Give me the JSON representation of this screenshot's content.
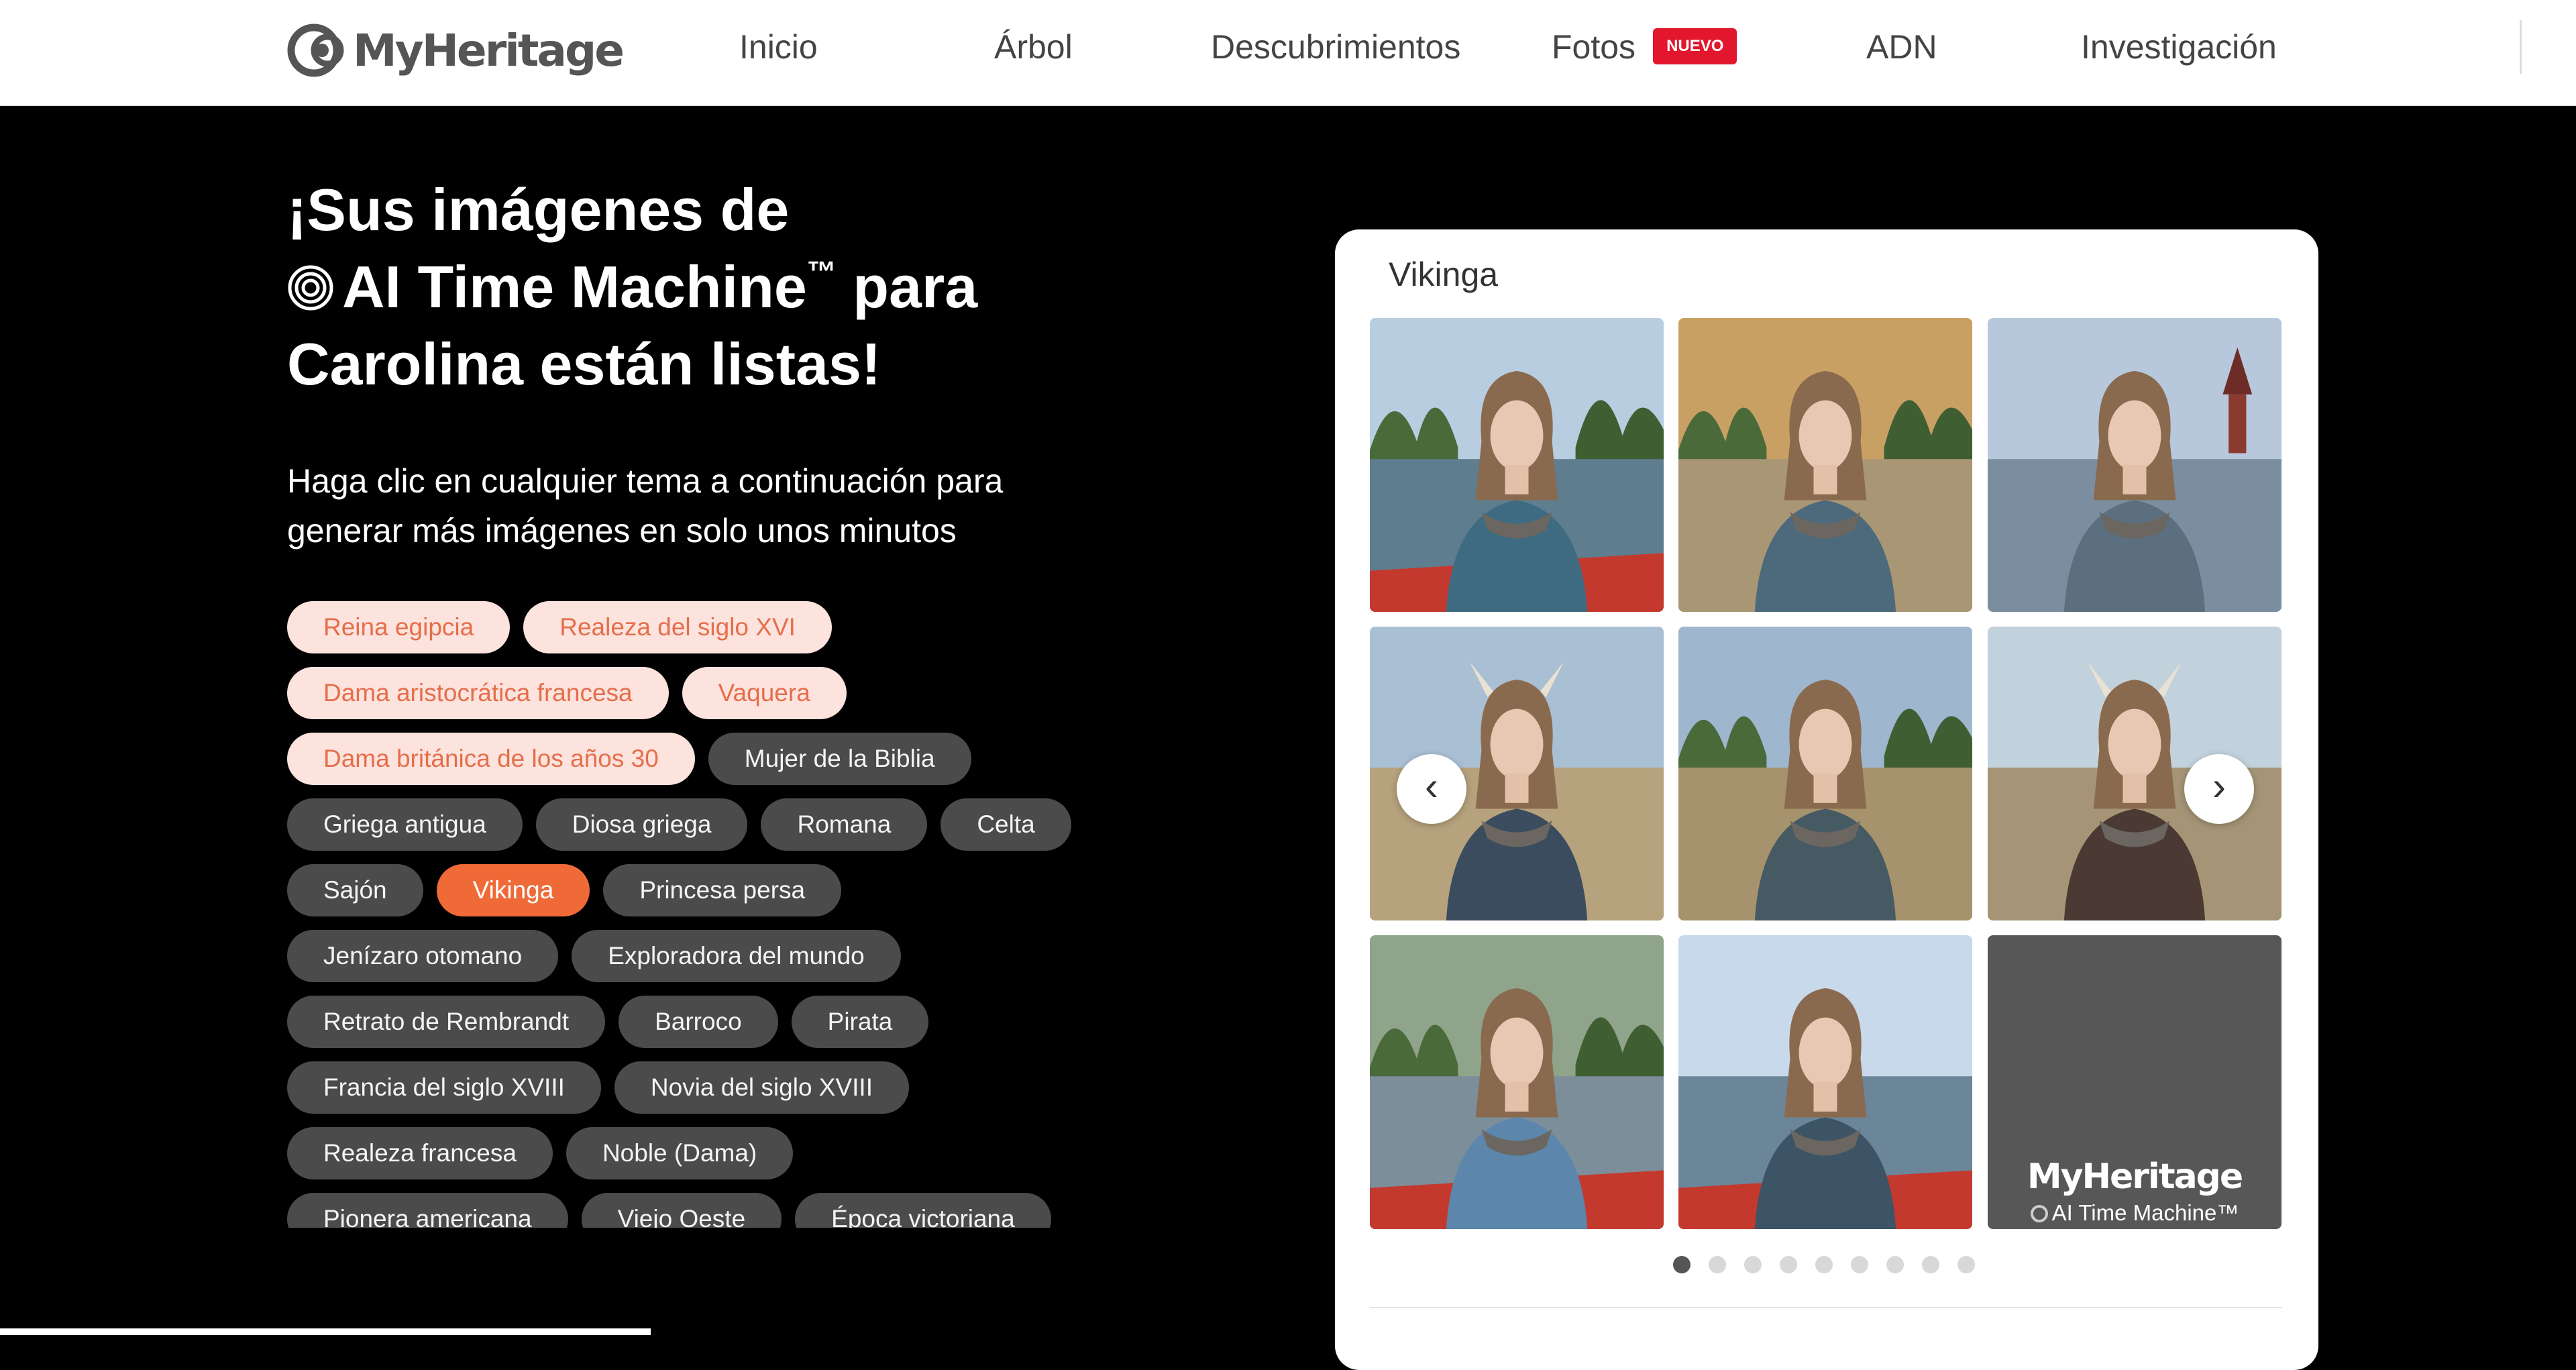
{
  "header": {
    "logo_text": "MyHeritage",
    "nav": [
      {
        "label": "Inicio"
      },
      {
        "label": "Árbol"
      },
      {
        "label": "Descubrimientos"
      },
      {
        "label": "Fotos",
        "badge": "NUEVO"
      },
      {
        "label": "ADN"
      },
      {
        "label": "Investigación"
      }
    ]
  },
  "hero": {
    "headline_line1": "¡Sus imágenes de",
    "headline_brand": "AI Time Machine",
    "headline_tm": "™",
    "headline_tail": " para",
    "headline_line3": "Carolina están listas!",
    "subtitle": "Haga clic en cualquier tema a continuación para generar más imágenes en solo unos minutos"
  },
  "themes": [
    [
      {
        "label": "Reina egipcia",
        "state": "done"
      },
      {
        "label": "Realeza del siglo XVI",
        "state": "done"
      }
    ],
    [
      {
        "label": "Dama aristocrática francesa",
        "state": "done"
      },
      {
        "label": "Vaquera",
        "state": "done"
      }
    ],
    [
      {
        "label": "Dama británica de los años 30",
        "state": "done"
      },
      {
        "label": "Mujer de la Biblia",
        "state": "gray"
      }
    ],
    [
      {
        "label": "Griega antigua",
        "state": "gray"
      },
      {
        "label": "Diosa griega",
        "state": "gray"
      },
      {
        "label": "Romana",
        "state": "gray"
      },
      {
        "label": "Celta",
        "state": "gray"
      }
    ],
    [
      {
        "label": "Sajón",
        "state": "gray"
      },
      {
        "label": "Vikinga",
        "state": "active"
      },
      {
        "label": "Princesa persa",
        "state": "gray"
      }
    ],
    [
      {
        "label": "Jenízaro otomano",
        "state": "gray"
      },
      {
        "label": "Exploradora del mundo",
        "state": "gray"
      }
    ],
    [
      {
        "label": "Retrato de Rembrandt",
        "state": "gray"
      },
      {
        "label": "Barroco",
        "state": "gray"
      },
      {
        "label": "Pirata",
        "state": "gray"
      }
    ],
    [
      {
        "label": "Francia del siglo XVIII",
        "state": "gray"
      },
      {
        "label": "Novia del siglo XVIII",
        "state": "gray"
      }
    ],
    [
      {
        "label": "Realeza francesa",
        "state": "gray"
      },
      {
        "label": "Noble (Dama)",
        "state": "gray"
      }
    ],
    [
      {
        "label": "Pionera americana",
        "state": "gray"
      },
      {
        "label": "Viejo Oeste",
        "state": "gray"
      },
      {
        "label": "Época victoriana",
        "state": "gray"
      }
    ]
  ],
  "gallery": {
    "title": "Vikinga",
    "photos": [
      {
        "scene": "lake-boat",
        "sky": "#b9cde0",
        "ground": "#5e7d8f",
        "sweater": "#3f6b82"
      },
      {
        "scene": "field",
        "sky": "#c9a063",
        "ground": "#a99674",
        "sweater": "#4d6a7c"
      },
      {
        "scene": "lake-church",
        "sky": "#b7c8dc",
        "ground": "#7b8ea0",
        "sweater": "#5c6f7e"
      },
      {
        "scene": "field-horns",
        "sky": "#a9bfd3",
        "ground": "#b6a27c",
        "sweater": "#3a4c5e"
      },
      {
        "scene": "field-trees",
        "sky": "#9fb6cf",
        "ground": "#a6926c",
        "sweater": "#465a63"
      },
      {
        "scene": "field-horns",
        "sky": "#c2d2dd",
        "ground": "#a59576",
        "sweater": "#4b3a33"
      },
      {
        "scene": "river-boat",
        "sky": "#8fa48a",
        "ground": "#7b8e99",
        "sweater": "#5c86ac"
      },
      {
        "scene": "harbor-boat",
        "sky": "#c7d9ea",
        "ground": "#6b8599",
        "sweater": "#3d5366"
      }
    ],
    "brand_tile": {
      "name": "MyHeritage",
      "sub": "AI Time Machine™"
    },
    "prev_icon": "‹",
    "next_icon": "›",
    "dots": 9,
    "active_dot": 0
  },
  "colors": {
    "accent": "#ef6a37",
    "done_bg": "#fde3dd",
    "done_text": "#e56e4b",
    "chip_gray": "#4b4b4b",
    "badge": "#e2172d"
  }
}
